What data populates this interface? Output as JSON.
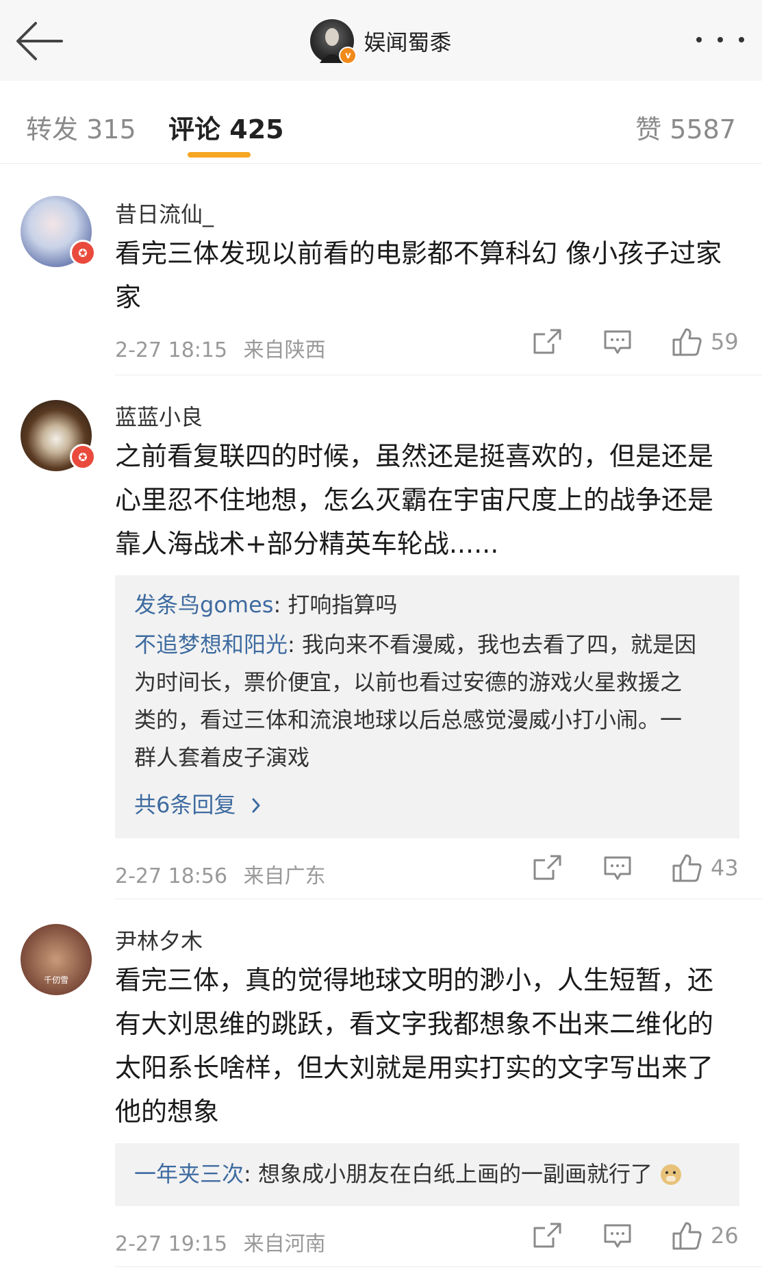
{
  "header": {
    "title": "娱闻蜀黍",
    "verified_badge": "v"
  },
  "tabs": {
    "repost": {
      "label": "转发",
      "count": "315"
    },
    "comment": {
      "label": "评论",
      "count": "425"
    },
    "like": {
      "label": "赞",
      "count": "5587"
    }
  },
  "colors": {
    "accent": "#f5a623",
    "link": "#3e6ba0",
    "meta": "#999999",
    "reply_bg": "#f2f2f2"
  },
  "comments": [
    {
      "user": "昔日流仙_",
      "text_lines": [
        "看完三体发现以前看的电影都不算科幻 像小孩子过家",
        "家"
      ],
      "time": "2-27 18:15",
      "location": "来自陕西",
      "likes": "59"
    },
    {
      "user": "蓝蓝小良",
      "text_lines": [
        "之前看复联四的时候，虽然还是挺喜欢的，但是还是",
        "心里忍不住地想，怎么灭霸在宇宙尺度上的战争还是",
        "靠人海战术+部分精英车轮战......"
      ],
      "replies": [
        {
          "name": "发条鸟gomes",
          "sep": ": ",
          "lines": [
            "打响指算吗"
          ]
        },
        {
          "name": "不追梦想和阳光",
          "sep": ": ",
          "lines": [
            "我向来不看漫威，我也去看了四，就是因",
            "为时间长，票价便宜，以前也看过安德的游戏火星救援之",
            "类的，看过三体和流浪地球以后总感觉漫威小打小闹。一",
            "群人套着皮子演戏"
          ]
        }
      ],
      "more_replies": "共6条回复",
      "time": "2-27 18:56",
      "location": "来自广东",
      "likes": "43"
    },
    {
      "user": "尹林夕木",
      "avatar_caption": "千仞雪",
      "text_lines": [
        "看完三体，真的觉得地球文明的渺小，人生短暂，还",
        "有大刘思维的跳跃，看文字我都想象不出来二维化的",
        "太阳系长啥样，但大刘就是用实打实的文字写出来了",
        "他的想象"
      ],
      "replies": [
        {
          "name": "一年夹三次",
          "sep": ": ",
          "lines": [
            "想象成小朋友在白纸上画的一副画就行了"
          ]
        }
      ],
      "time": "2-27 19:15",
      "location": "来自河南",
      "likes": "26"
    }
  ]
}
